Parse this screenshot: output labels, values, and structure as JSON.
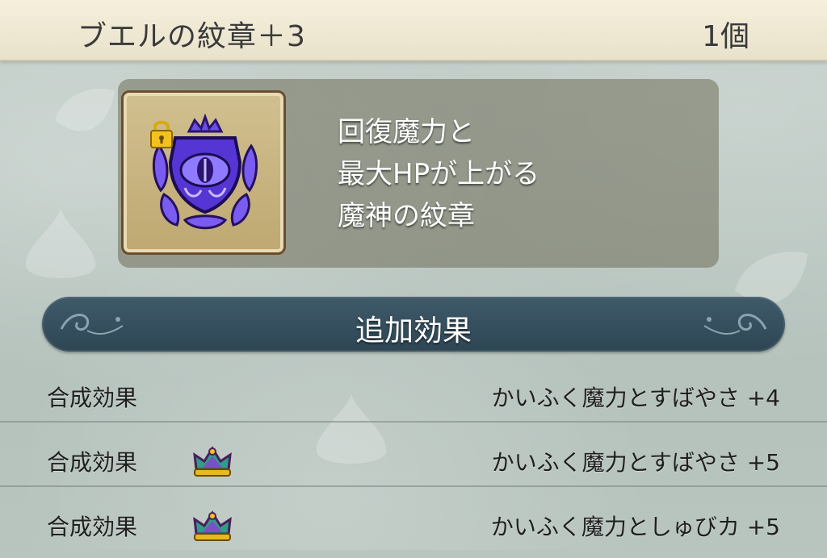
{
  "header": {
    "item_name": "ブエルの紋章＋3",
    "item_count": "1個"
  },
  "item_card": {
    "icon": "buel-emblem-icon",
    "locked": true,
    "description_lines": [
      "回復魔力と",
      "最大HPが上がる",
      "魔神の紋章"
    ]
  },
  "section": {
    "title": "追加効果"
  },
  "effects": [
    {
      "label": "合成効果",
      "crown_icon": false,
      "value": "かいふく魔力とすばやさ +4"
    },
    {
      "label": "合成効果",
      "crown_icon": true,
      "value": "かいふく魔力とすばやさ +5"
    },
    {
      "label": "合成効果",
      "crown_icon": true,
      "value": "かいふく魔力としゅびカ +5"
    }
  ],
  "colors": {
    "header_bg": "#efe8d2",
    "banner_bg": "#35505f",
    "panel_bg": "#6e6e5a",
    "emblem_purple": "#5b3bd6",
    "lock_gold": "#e8b81e"
  }
}
